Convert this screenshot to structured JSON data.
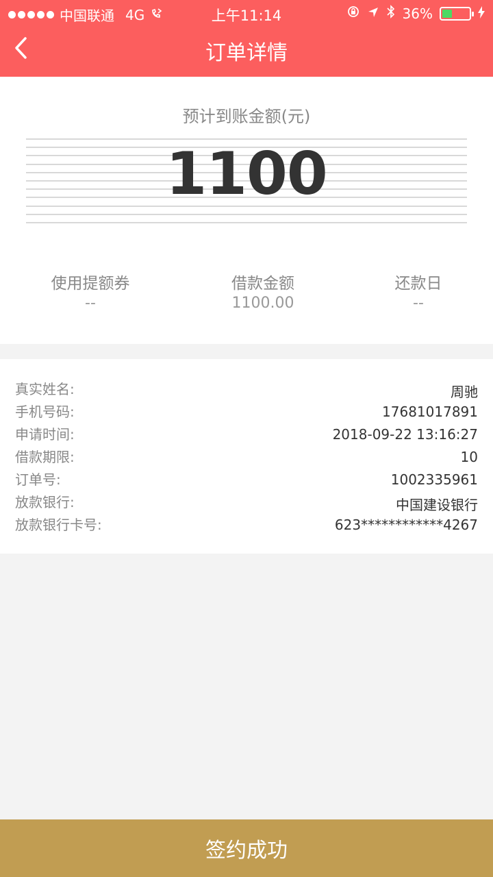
{
  "status_bar": {
    "carrier": "中国联通",
    "network": "4G",
    "time": "上午11:14",
    "battery": "36%"
  },
  "nav": {
    "title": "订单详情",
    "back_icon": "chevron-left-icon"
  },
  "amount_card": {
    "label": "预计到账金额(元)",
    "amount": "1100",
    "columns": [
      {
        "title": "使用提额券",
        "value": "--"
      },
      {
        "title": "借款金额",
        "value": "1100.00"
      },
      {
        "title": "还款日",
        "value": "--"
      }
    ]
  },
  "details": [
    {
      "key": "真实姓名:",
      "value": "周驰"
    },
    {
      "key": "手机号码:",
      "value": "17681017891"
    },
    {
      "key": "申请时间:",
      "value": "2018-09-22 13:16:27"
    },
    {
      "key": "借款期限:",
      "value": "10"
    },
    {
      "key": "订单号:",
      "value": "1002335961"
    },
    {
      "key": "放款银行:",
      "value": "中国建设银行"
    },
    {
      "key": "放款银行卡号:",
      "value": "623************4267"
    }
  ],
  "bottom_button": {
    "label": "签约成功"
  },
  "colors": {
    "header": "#fc5e5e",
    "button": "#c19d52",
    "battery_fill": "#4cd964"
  }
}
